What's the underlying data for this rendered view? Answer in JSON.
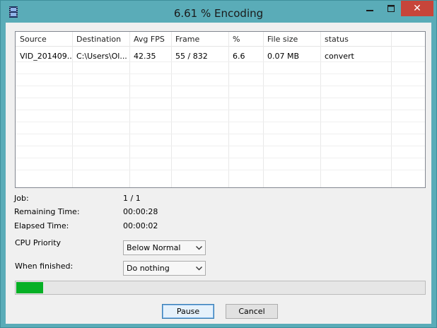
{
  "window": {
    "title": "6.61 % Encoding",
    "close_glyph": "✕"
  },
  "list": {
    "columns": [
      "Source",
      "Destination",
      "Avg FPS",
      "Frame",
      "%",
      "File size",
      "status"
    ],
    "rows": [
      {
        "source": "VID_201409...",
        "destination": "C:\\Users\\Ol...",
        "avg_fps": "42.35",
        "frame": "55 / 832",
        "percent": "6.6",
        "file_size": "0.07 MB",
        "status": "convert"
      }
    ]
  },
  "info": {
    "job_label": "Job:",
    "job_value": "1 / 1",
    "remaining_label": "Remaining Time:",
    "remaining_value": "00:00:28",
    "elapsed_label": "Elapsed Time:",
    "elapsed_value": "00:00:02",
    "cpu_label": "CPU Priority",
    "cpu_value": "Below Normal",
    "finished_label": "When finished:",
    "finished_value": "Do nothing"
  },
  "progress": {
    "percent": 6.61
  },
  "buttons": {
    "pause": "Pause",
    "cancel": "Cancel"
  }
}
